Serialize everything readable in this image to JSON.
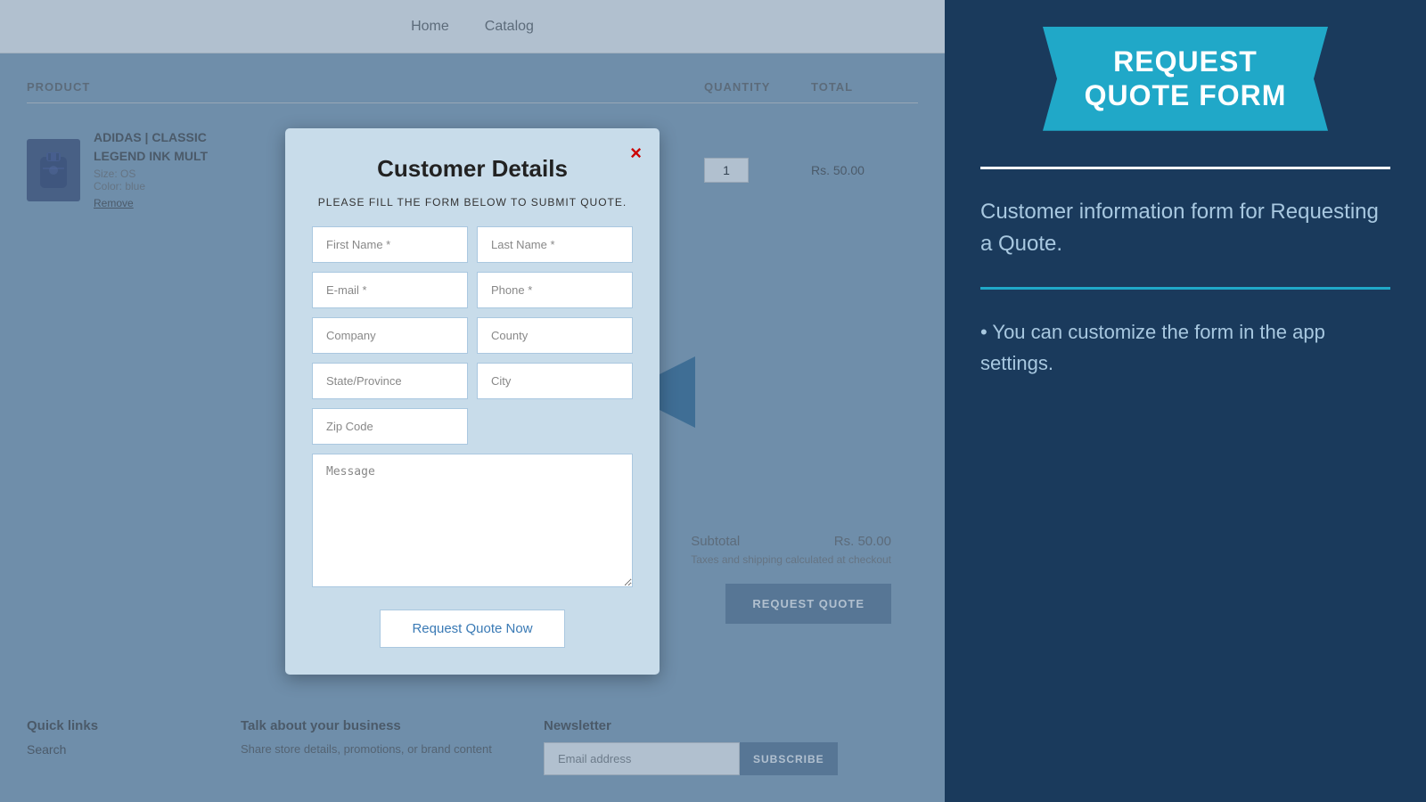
{
  "nav": {
    "links": [
      "Home",
      "Catalog"
    ]
  },
  "page": {
    "product_col": "PRODUCT",
    "quantity_col": "QUANTITY",
    "total_col": "TOTAL"
  },
  "product": {
    "name": "ADIDAS | CLASSIC",
    "name2": "LEGEND INK MULT",
    "size": "Size: OS",
    "color": "Color: blue",
    "remove": "Remove",
    "quantity": "1",
    "price": "Rs. 50.00"
  },
  "subtotal": {
    "label": "Subtotal",
    "amount": "Rs. 50.00",
    "taxes_note": "Taxes and shipping calculated at checkout"
  },
  "request_quote_btn": "REQUEST QUOTE",
  "footer": {
    "quick_links_heading": "Quick links",
    "search_link": "Search",
    "business_heading": "Talk about your business",
    "business_desc": "Share store details, promotions, or brand content",
    "newsletter_heading": "Newsletter",
    "email_placeholder": "Email address",
    "subscribe_btn": "SUBSCRIBE"
  },
  "modal": {
    "title": "Customer Details",
    "subtitle": "PLEASE FILL THE FORM BELOW TO SUBMIT QUOTE.",
    "close": "×",
    "fields": {
      "first_name": "First Name *",
      "last_name": "Last Name *",
      "email": "E-mail *",
      "phone": "Phone *",
      "company": "Company",
      "county": "County",
      "state_province": "State/Province",
      "city": "City",
      "zip_code": "Zip Code",
      "message": "Message"
    },
    "submit_btn": "Request Quote Now"
  },
  "right_panel": {
    "banner_line1": "REQUEST",
    "banner_line2": "QUOTE FORM",
    "description": "Customer information form for Requesting a Quote.",
    "tip": "• You can customize the form in the app settings."
  }
}
